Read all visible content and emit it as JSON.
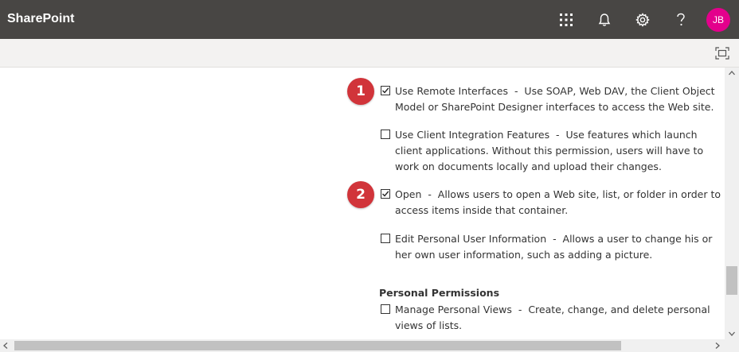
{
  "app": {
    "title": "SharePoint"
  },
  "header": {
    "avatar_initials": "JB"
  },
  "permissions": [
    {
      "name": "Use Remote Interfaces",
      "description": "Use SOAP, Web DAV, the Client Object Model or SharePoint Designer interfaces to access the Web site.",
      "checked": true,
      "marker": "1"
    },
    {
      "name": "Use Client Integration Features",
      "description": "Use features which launch client applications. Without this permission, users will have to work on documents locally and upload their changes.",
      "checked": false
    },
    {
      "name": "Open",
      "description": "Allows users to open a Web site, list, or folder in order to access items inside that container.",
      "checked": true,
      "marker": "2"
    },
    {
      "name": "Edit Personal User Information",
      "description": "Allows a user to change his or her own user information, such as adding a picture.",
      "checked": false
    }
  ],
  "personal_section": {
    "title": "Personal Permissions",
    "items": [
      {
        "name": "Manage Personal Views",
        "description": "Create, change, and delete personal views of lists.",
        "checked": false
      }
    ]
  },
  "colors": {
    "suitebar": "#484644",
    "avatar": "#e3008c",
    "marker": "#d1343a"
  }
}
